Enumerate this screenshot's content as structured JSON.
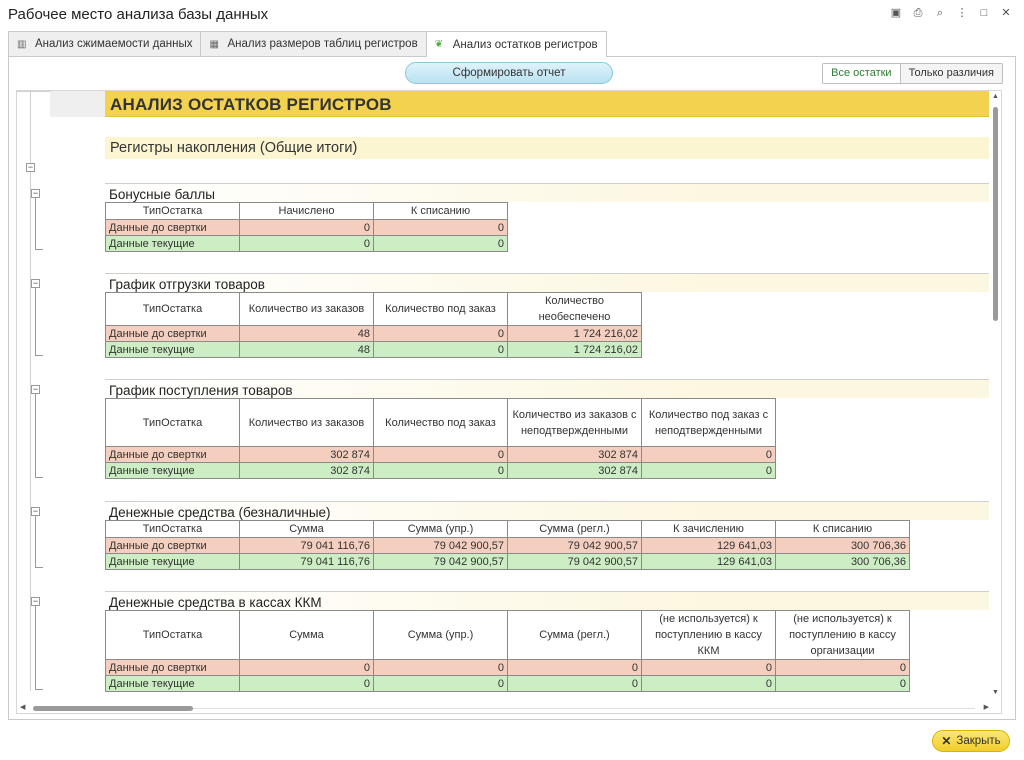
{
  "window": {
    "title": "Рабочее место анализа базы данных"
  },
  "tabs": [
    {
      "label": "Анализ сжимаемости данных",
      "icon": "chart-icon"
    },
    {
      "label": "Анализ размеров таблиц регистров",
      "icon": "table-icon"
    },
    {
      "label": "Анализ остатков регистров",
      "icon": "leaf-icon"
    }
  ],
  "toolbar": {
    "generate_label": "Сформировать отчет",
    "all_balances": "Все остатки",
    "only_diff": "Только различия"
  },
  "report": {
    "title": "АНАЛИЗ ОСТАТКОВ РЕГИСТРОВ",
    "subtitle": "Регистры накопления (Общие итоги)",
    "row_before": "Данные до свертки",
    "row_current": "Данные текущие",
    "type_col": "ТипОстатка",
    "sections": [
      {
        "name": "Бонусные баллы",
        "columns": [
          "Начислено",
          "К списанию"
        ],
        "before": [
          "0",
          "0"
        ],
        "current": [
          "0",
          "0"
        ]
      },
      {
        "name": "График отгрузки товаров",
        "columns": [
          "Количество из заказов",
          "Количество под заказ",
          "Количество необеспечено"
        ],
        "before": [
          "48",
          "0",
          "1 724 216,02"
        ],
        "current": [
          "48",
          "0",
          "1 724 216,02"
        ]
      },
      {
        "name": "График поступления товаров",
        "columns": [
          "Количество из заказов",
          "Количество под заказ",
          "Количество из заказов с неподтвержденными",
          "Количество под заказ с неподтвержденными"
        ],
        "before": [
          "302 874",
          "0",
          "302 874",
          "0"
        ],
        "current": [
          "302 874",
          "0",
          "302 874",
          "0"
        ]
      },
      {
        "name": "Денежные средства (безналичные)",
        "columns": [
          "Сумма",
          "Сумма (упр.)",
          "Сумма (регл.)",
          "К зачислению",
          "К списанию"
        ],
        "before": [
          "79 041 116,76",
          "79 042 900,57",
          "79 042 900,57",
          "129 641,03",
          "300 706,36"
        ],
        "current": [
          "79 041 116,76",
          "79 042 900,57",
          "79 042 900,57",
          "129 641,03",
          "300 706,36"
        ]
      },
      {
        "name": "Денежные средства в кассах ККМ",
        "columns": [
          "Сумма",
          "Сумма (упр.)",
          "Сумма (регл.)",
          "(не используется) к поступлению в кассу ККМ",
          "(не используется) к поступлению в кассу организации"
        ],
        "before": [
          "0",
          "0",
          "0",
          "0",
          "0"
        ],
        "current": [
          "0",
          "0",
          "0",
          "0",
          "0"
        ]
      }
    ]
  },
  "footer": {
    "close_label": "Закрыть"
  },
  "colors": {
    "header_yellow": "#f2d24e",
    "before_row": "#f4cfc0",
    "current_row": "#cdeec4",
    "accent_green": "#2e7d32"
  }
}
